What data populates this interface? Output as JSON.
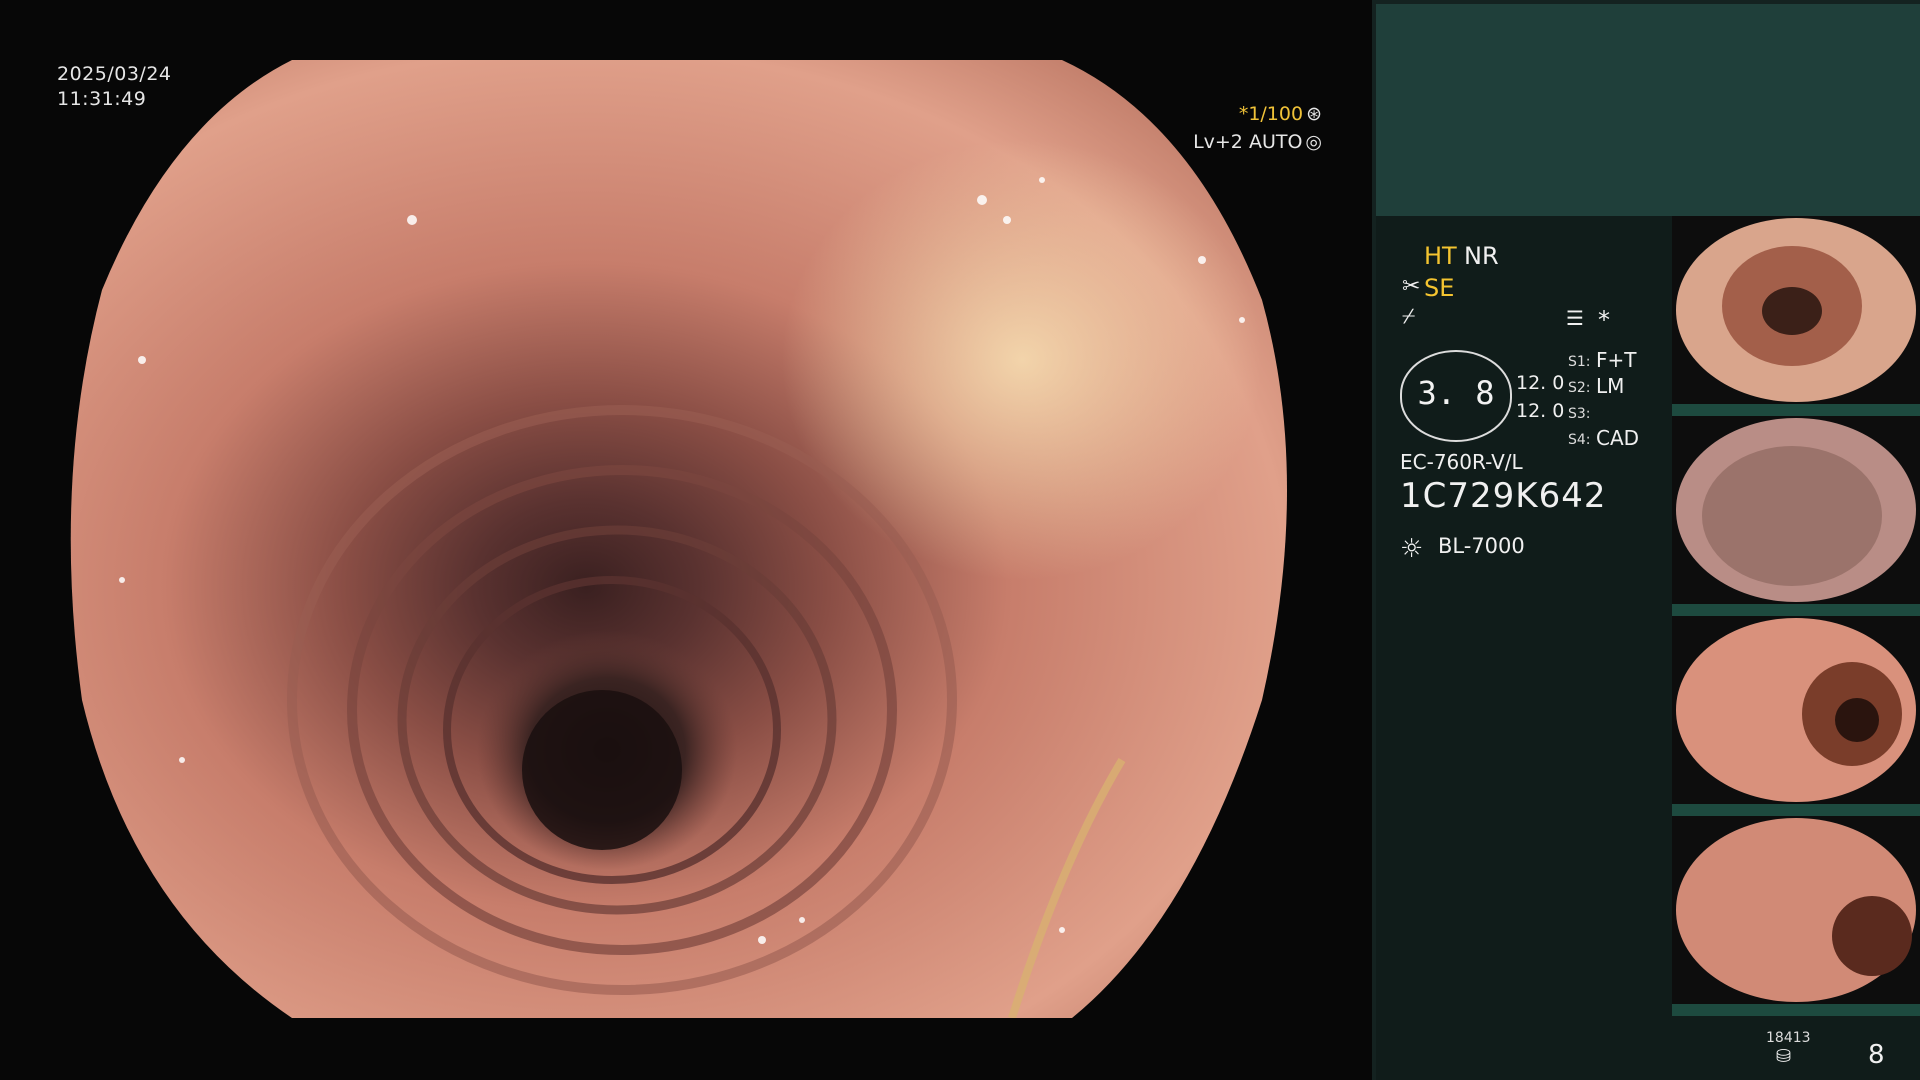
{
  "overlay": {
    "date": "2025/03/24",
    "time": "11:31:49",
    "shutter": "*1/100",
    "level": "Lv+2 AUTO"
  },
  "status": {
    "ht": "HT",
    "nr": "NR",
    "se": "SE",
    "star": "*",
    "gauge_value": "3. 8",
    "val1": "12. 0",
    "val2": "12. 0",
    "s1_label": "S1:",
    "s1_value": "F+T",
    "s2_label": "S2:",
    "s2_value": "LM",
    "s3_label": "S3:",
    "s3_value": "",
    "s4_label": "S4:",
    "s4_value": "CAD",
    "scope_model": "EC-760R-V/L",
    "serial": "1C729K642",
    "light_source": "BL-7000"
  },
  "footer": {
    "storage_count": "18413",
    "image_count": "8"
  },
  "icons": {
    "shutter": "aperture-icon",
    "auto": "ring-icon",
    "scissor": "scissor-icon",
    "fiber": "fiber-icon",
    "menu": "menu-icon",
    "light": "sun-icon",
    "storage": "storage-icon"
  },
  "colors": {
    "accent_yellow": "#f4c430",
    "panel_top": "#1f3f3a",
    "panel": "#101c1a",
    "thumb_border": "#1d4a3f"
  }
}
